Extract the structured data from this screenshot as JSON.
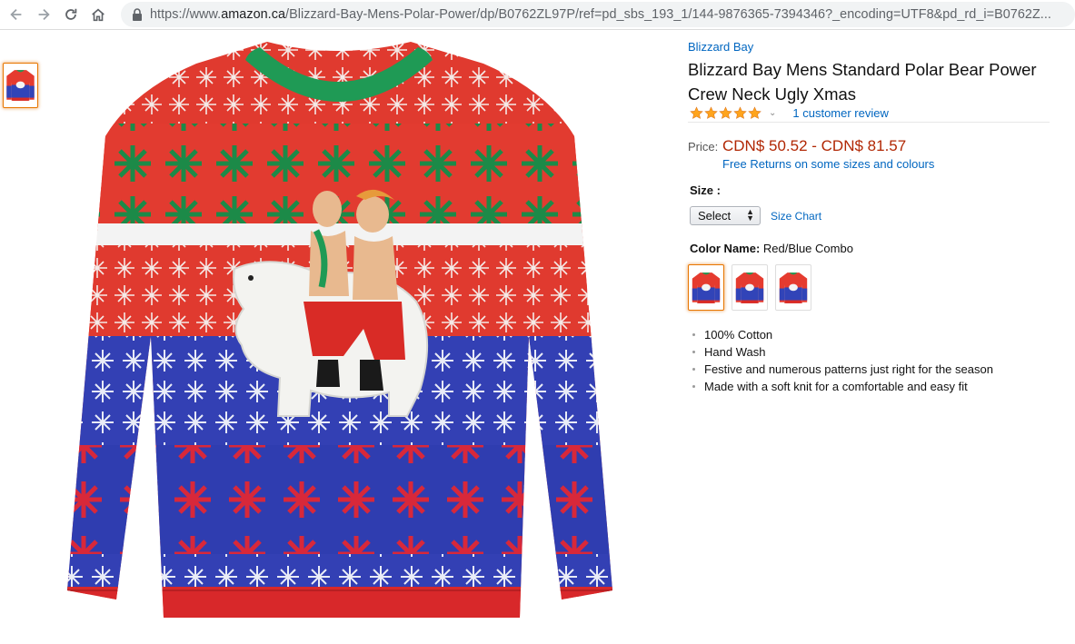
{
  "browser": {
    "url_prefix": "https://www.",
    "url_host": "amazon.ca",
    "url_path": "/Blizzard-Bay-Mens-Polar-Power/dp/B0762ZL97P/ref=pd_sbs_193_1/144-9876365-7394346?_encoding=UTF8&pd_rd_i=B0762Z..."
  },
  "product": {
    "brand": "Blizzard Bay",
    "title": "Blizzard Bay Mens Standard Polar Bear Power Crew Neck Ugly Xmas",
    "rating": {
      "stars": 5,
      "review_text": "1 customer review"
    },
    "price_label": "Price:",
    "price": "CDN$ 50.52 - CDN$ 81.57",
    "returns_text": "Free Returns on some sizes and colours",
    "size_label": "Size :",
    "size_selected": "Select",
    "size_chart": "Size Chart",
    "color_label": "Color Name:",
    "color_value": "Red/Blue Combo",
    "features": [
      "100% Cotton",
      "Hand Wash",
      "Festive and numerous patterns just right for the season",
      "Made with a soft knit for a comfortable and easy fit"
    ]
  },
  "colors": {
    "link": "#0066c0",
    "price": "#b12704",
    "selected_border": "#e77600",
    "star": "#ffa41c"
  },
  "icons": [
    "back-arrow-icon",
    "forward-arrow-icon",
    "reload-icon",
    "home-icon",
    "lock-icon",
    "star-icon",
    "chevron-down-icon"
  ]
}
